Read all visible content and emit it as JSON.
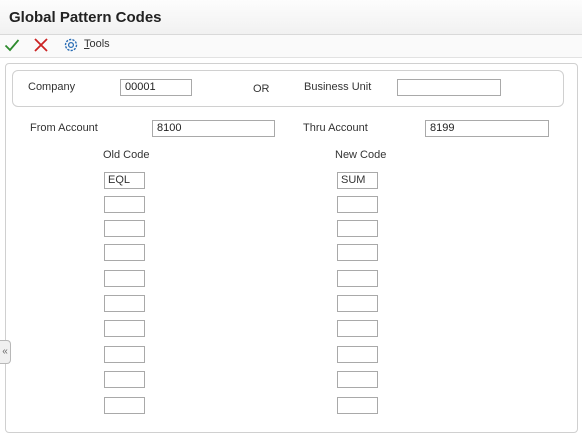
{
  "window": {
    "title": "Global Pattern Codes"
  },
  "toolbar": {
    "ok_icon": "checkmark-icon",
    "cancel_icon": "x-icon",
    "tools_icon": "gear-icon",
    "tools_label": "Tools"
  },
  "header": {
    "company_label": "Company",
    "company_value": "00001",
    "or_label": "OR",
    "business_unit_label": "Business Unit",
    "business_unit_value": "",
    "from_account_label": "From Account",
    "from_account_value": "8100",
    "thru_account_label": "Thru Account",
    "thru_account_value": "8199"
  },
  "codes": {
    "old_code_label": "Old Code",
    "new_code_label": "New Code",
    "old_codes": [
      "EQL",
      "",
      "",
      "",
      "",
      "",
      "",
      "",
      "",
      ""
    ],
    "new_codes": [
      "SUM",
      "",
      "",
      "",
      "",
      "",
      "",
      "",
      "",
      ""
    ]
  },
  "colors": {
    "ok": "#2e8b2e",
    "cancel": "#cc2222",
    "tools": "#2a6db5"
  }
}
